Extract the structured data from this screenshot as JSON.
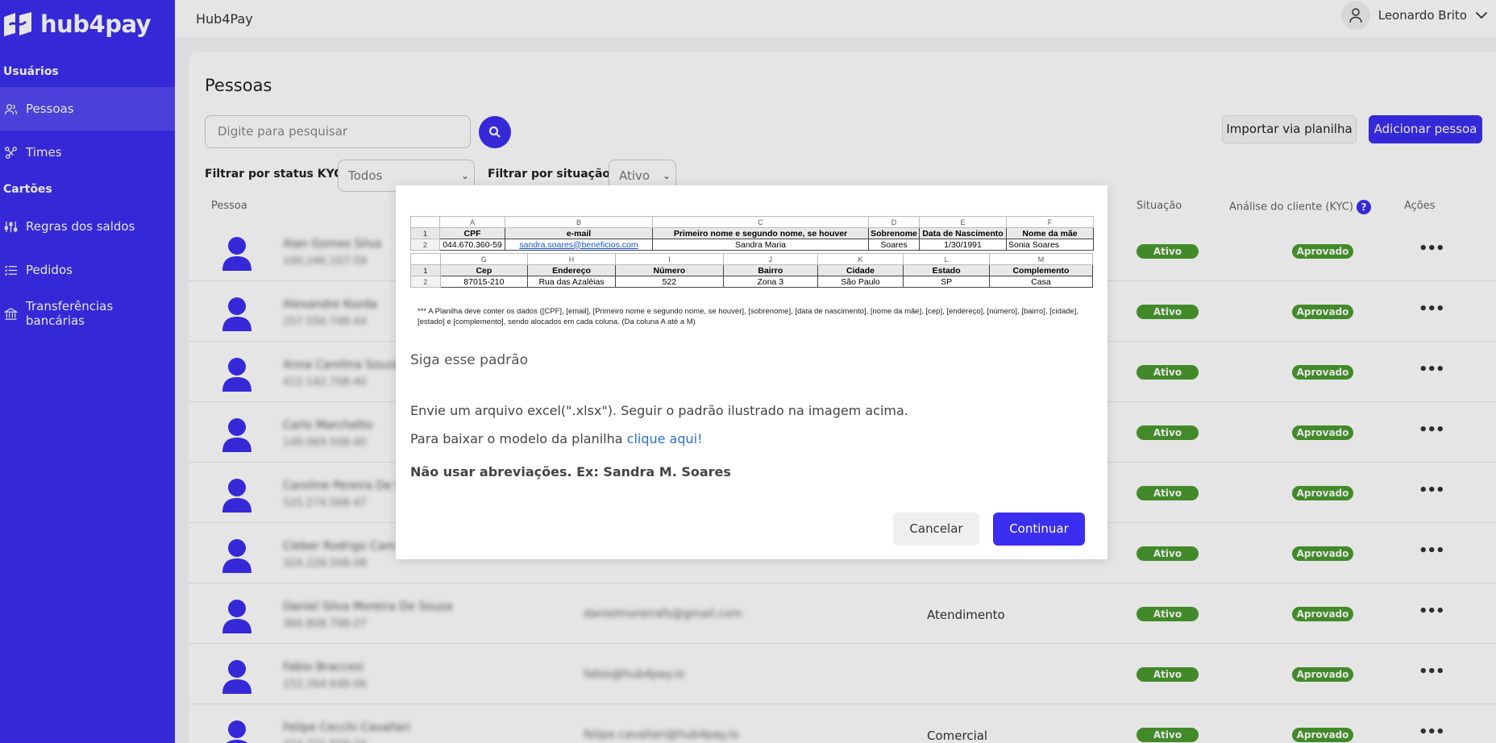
{
  "brand": {
    "name": "hub4pay"
  },
  "sidebar": {
    "sections": [
      {
        "title": "Usuários"
      },
      {
        "title": "Cartões"
      }
    ],
    "items": [
      {
        "label": "Pessoas",
        "icon": "users-icon"
      },
      {
        "label": "Times",
        "icon": "team-icon"
      },
      {
        "label": "Regras dos saldos",
        "icon": "sliders-icon"
      },
      {
        "label": "Pedidos",
        "icon": "list-icon"
      },
      {
        "label": "Transferências bancárias",
        "icon": "bank-icon"
      }
    ]
  },
  "topbar": {
    "title": "Hub4Pay",
    "user": "Leonardo Brito"
  },
  "page": {
    "title": "Pessoas",
    "search_placeholder": "Digite para pesquisar",
    "import_button": "Importar via planilha",
    "add_button": "Adicionar pessoa",
    "filter_kyc_label": "Filtrar por status KYC:",
    "filter_kyc_value": "Todos",
    "filter_situation_label": "Filtrar por situação:",
    "filter_situation_value": "Ativo"
  },
  "table": {
    "headers": {
      "person": "Pessoa",
      "situation": "Situação",
      "kyc": "Análise do cliente (KYC)",
      "actions": "Ações"
    },
    "rows": [
      {
        "name": "Alan Gomes Silva",
        "doc": "100.246.107-59",
        "email": "",
        "team": "",
        "situation": "Ativo",
        "kyc": "Aprovado"
      },
      {
        "name": "Alexandre Kozda",
        "doc": "257.556.748-44",
        "email": "",
        "team": "",
        "situation": "Ativo",
        "kyc": "Aprovado"
      },
      {
        "name": "Anna Carolina Souza",
        "doc": "412.142.708-40",
        "email": "",
        "team": "",
        "situation": "Ativo",
        "kyc": "Aprovado"
      },
      {
        "name": "Carlo Marchetto",
        "doc": "149.069.508-40",
        "email": "",
        "team": "",
        "situation": "Ativo",
        "kyc": "Aprovado"
      },
      {
        "name": "Caroline Pereira De S",
        "doc": "525.274.568-47",
        "email": "",
        "team": "",
        "situation": "Ativo",
        "kyc": "Aprovado"
      },
      {
        "name": "Cleber Rodrigo Cam",
        "doc": "324.228.508-08",
        "email": "",
        "team": "",
        "situation": "Ativo",
        "kyc": "Aprovado"
      },
      {
        "name": "Daniel Silva Moreira De Souza",
        "doc": "366.808.798-27",
        "email": "danielmoreirafs@gmail.com",
        "team": "Atendimento",
        "situation": "Ativo",
        "kyc": "Aprovado"
      },
      {
        "name": "Fabio Braccesi",
        "doc": "152.264.648-06",
        "email": "fabio@hub4pay.io",
        "team": "",
        "situation": "Ativo",
        "kyc": "Aprovado"
      },
      {
        "name": "Felipe Cecchi Cavallari",
        "doc": "424.721.558-24",
        "email": "felipe.cavallari@hub4pay.io",
        "team": "Comercial",
        "situation": "Ativo",
        "kyc": "Aprovado"
      }
    ]
  },
  "modal": {
    "sheet": {
      "row1_letters": [
        "A",
        "B",
        "C",
        "D",
        "E",
        "F"
      ],
      "row1_headers": [
        "CPF",
        "e-mail",
        "Primeiro nome e segundo nome, se houver",
        "Sobrenome",
        "Data de Nascimento",
        "Nome da mãe"
      ],
      "row1_values": [
        "044.670.360-59",
        "sandra.soares@beneficios.com",
        "Sandra Maria",
        "Soares",
        "1/30/1991",
        "Sonia Soares"
      ],
      "row2_letters": [
        "G",
        "H",
        "I",
        "J",
        "K",
        "L",
        "M"
      ],
      "row2_headers": [
        "Cep",
        "Endereço",
        "Número",
        "Bairro",
        "Cidade",
        "Estado",
        "Complemento"
      ],
      "row2_values": [
        "87015-210",
        "Rua das Azaléias",
        "522",
        "Zona 3",
        "São Paulo",
        "SP",
        "Casa"
      ],
      "row_numbers": [
        "1",
        "2"
      ],
      "note": "*** A Planilha deve conter os dados ([CPF], [email], [Primeiro nome e segundo nome, se houver], [sobrenome], [data de nascimento], [nome da mãe], [cep], [endereço], [número], [bairro], [cidade], [estado] e [complemento], sendo alocados em cada coluna. (Da coluna A até a M)"
    },
    "title": "Siga esse padrão",
    "text1": "Envie um arquivo excel(\".xlsx\"). Seguir o padrão ilustrado na imagem acima.",
    "text2_prefix": "Para baixar o modelo da planilha ",
    "text2_link": "clique aqui!",
    "text3": "Não usar abreviações. Ex: Sandra M. Soares",
    "cancel": "Cancelar",
    "continue": "Continuar"
  },
  "colors": {
    "primary": "#3b2ef0",
    "badge": "#4a9a2e"
  }
}
